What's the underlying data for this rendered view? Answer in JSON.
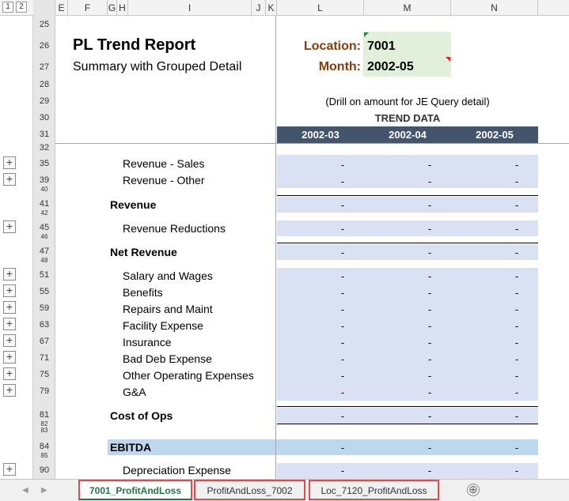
{
  "outline_levels": [
    "1",
    "2"
  ],
  "columns": [
    "E",
    "F",
    "G",
    "H",
    "I",
    "J",
    "K",
    "L",
    "M",
    "N"
  ],
  "report": {
    "title": "PL Trend Report",
    "subtitle": "Summary with Grouped Detail",
    "location_label": "Location:",
    "location_value": "7001",
    "month_label": "Month:",
    "month_value": "2002-05",
    "drill_note": "(Drill on amount for JE Query detail)",
    "trend_header": "TREND DATA",
    "periods": [
      "2002-03",
      "2002-04",
      "2002-05"
    ]
  },
  "header_rows": [
    "25",
    "26",
    "27",
    "28",
    "29",
    "30",
    "31",
    "32"
  ],
  "lines": [
    {
      "row": "35",
      "label": "Revenue - Sales",
      "values": [
        "-",
        "-",
        "-"
      ]
    },
    {
      "row": "39",
      "label": "Revenue - Other",
      "values": [
        "-",
        "-",
        "-"
      ]
    },
    {
      "row": "41",
      "label": "Revenue",
      "values": [
        "-",
        "-",
        "-"
      ]
    },
    {
      "row": "45",
      "label": "Revenue Reductions",
      "values": [
        "-",
        "-",
        "-"
      ]
    },
    {
      "row": "47",
      "label": "Net Revenue",
      "values": [
        "-",
        "-",
        "-"
      ]
    },
    {
      "row": "51",
      "label": "Salary and Wages",
      "values": [
        "-",
        "-",
        "-"
      ]
    },
    {
      "row": "55",
      "label": "Benefits",
      "values": [
        "-",
        "-",
        "-"
      ]
    },
    {
      "row": "59",
      "label": "Repairs and Maint",
      "values": [
        "-",
        "-",
        "-"
      ]
    },
    {
      "row": "63",
      "label": "Facility Expense",
      "values": [
        "-",
        "-",
        "-"
      ]
    },
    {
      "row": "67",
      "label": "Insurance",
      "values": [
        "-",
        "-",
        "-"
      ]
    },
    {
      "row": "71",
      "label": "Bad Deb Expense",
      "values": [
        "-",
        "-",
        "-"
      ]
    },
    {
      "row": "75",
      "label": "Other Operating Expenses",
      "values": [
        "-",
        "-",
        "-"
      ]
    },
    {
      "row": "79",
      "label": "G&A",
      "values": [
        "-",
        "-",
        "-"
      ]
    },
    {
      "row": "81",
      "label": "Cost of Ops",
      "values": [
        "-",
        "-",
        "-"
      ]
    },
    {
      "row": "84",
      "label": "EBITDA",
      "values": [
        "-",
        "-",
        "-"
      ]
    },
    {
      "row": "90",
      "label": "Depreciation Expense",
      "values": [
        "-",
        "-",
        "-"
      ]
    }
  ],
  "cramped_rows": [
    "40",
    "42",
    "46",
    "48",
    "82",
    "83",
    "85"
  ],
  "sheet_tabs": [
    "7001_ProfitAndLoss",
    "ProfitAndLoss_7002",
    "Loc_7120_ProfitAndLoss"
  ],
  "active_tab": "7001_ProfitAndLoss",
  "add_sheet_icon": "⊕",
  "expand_icon": "+",
  "colors": {
    "accent_label": "#843c0c",
    "param_fill": "#e2efda",
    "header_fill": "#44546a",
    "band_fill": "#d9e1f2",
    "ebitda_fill": "#bdd7ee",
    "active_tab_text": "#217346",
    "tab_highlight": "#e24b4b"
  }
}
